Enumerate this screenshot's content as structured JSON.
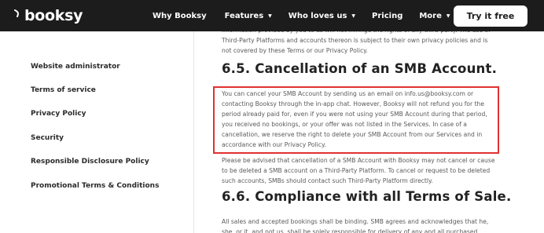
{
  "brand": {
    "name": "booksy"
  },
  "nav": {
    "items": [
      {
        "label": "Why Booksy",
        "has_caret": false
      },
      {
        "label": "Features",
        "has_caret": true
      },
      {
        "label": "Who loves us",
        "has_caret": true
      },
      {
        "label": "Pricing",
        "has_caret": false
      },
      {
        "label": "More",
        "has_caret": true
      }
    ],
    "cta_label": "Try it free"
  },
  "sidebar": {
    "items": [
      {
        "label": "Website administrator"
      },
      {
        "label": "Terms of service"
      },
      {
        "label": "Privacy Policy"
      },
      {
        "label": "Security"
      },
      {
        "label": "Responsible Disclosure Policy"
      },
      {
        "label": "Promotional Terms & Conditions"
      }
    ]
  },
  "content": {
    "top_paragraph": "information provided by you to us will not infringe the rights of any third-party. The use of Third-Party Platforms and accounts thereon is subject to their own privacy policies and is not covered by these Terms or our Privacy Policy.",
    "heading_65": "6.5. Cancellation of an SMB Account.",
    "highlighted_paragraph": "You can cancel your SMB Account by sending us an email on info.us@booksy.com or contacting Booksy through the in-app chat. However, Booksy will not refund you for the period already paid for, even if you were not using your SMB Account during that period, you received no bookings, or your offer was not listed in the Services. In case of a cancellation, we reserve the right to delete your SMB Account from our Services and in accordance with our Privacy Policy.",
    "advised_paragraph": "Please be advised that cancellation of a SMB Account with Booksy may not cancel or cause to be deleted a SMB account on a Third-Party Platform. To cancel or request to be deleted such accounts, SMBs should contact such Third-Party Platform directly.",
    "heading_66": "6.6. Compliance with all Terms of Sale.",
    "bottom_paragraph": "All sales and accepted bookings shall be binding. SMB agrees and acknowledges that he, she, or it, and not us, shall be solely responsible for delivery of any and all purchased"
  },
  "colors": {
    "header_bg": "#1c1c1c",
    "highlight_border": "#e03131",
    "cta_bg": "#ffffff"
  }
}
